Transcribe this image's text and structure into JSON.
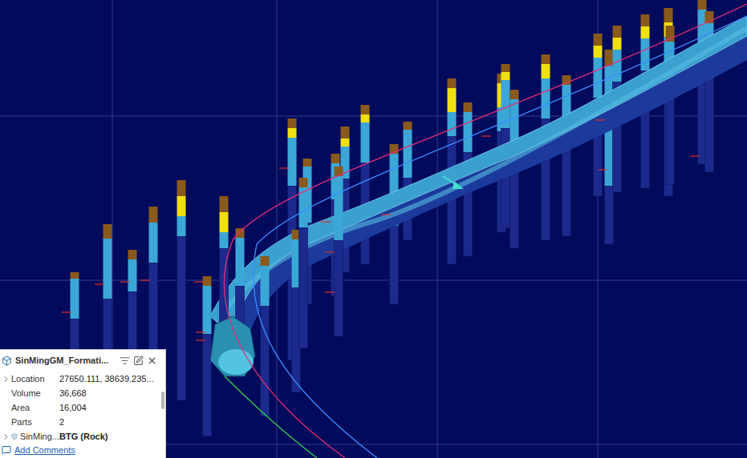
{
  "properties_panel": {
    "title": "SinMingGM_Formati...",
    "rows": [
      {
        "label": "Location",
        "value": "27650.111, 38639.235...",
        "expandable": true,
        "expanded": false
      },
      {
        "label": "Volume",
        "value": "36,668",
        "expandable": false,
        "expanded": false
      },
      {
        "label": "Area",
        "value": "16,004",
        "expandable": false,
        "expanded": false
      },
      {
        "label": "Parts",
        "value": "2",
        "expandable": false,
        "expanded": false
      }
    ],
    "child": {
      "label": "SinMing...",
      "value": "BTG (Rock)",
      "expandable": true,
      "expanded": false
    },
    "link": "Add Comments"
  }
}
